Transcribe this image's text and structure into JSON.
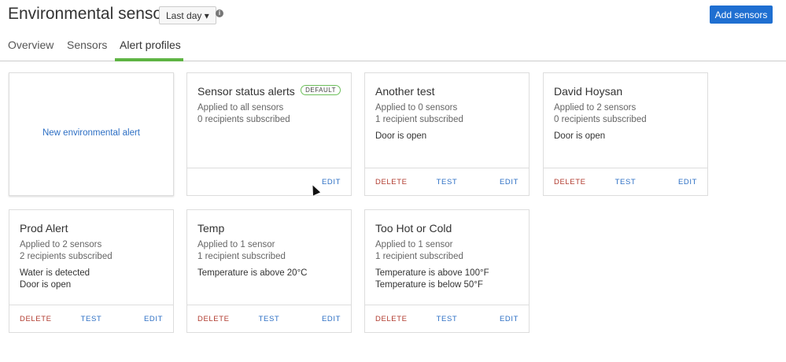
{
  "header": {
    "title": "Environmental sensors",
    "range": "Last day ▾",
    "info_icon": "i",
    "add_button": "Add sensors"
  },
  "tabs": [
    {
      "label": "Overview"
    },
    {
      "label": "Sensors"
    },
    {
      "label": "Alert profiles",
      "active": true
    }
  ],
  "new_alert": "New environmental alert",
  "actions": {
    "delete": "DELETE",
    "test": "TEST",
    "edit": "EDIT"
  },
  "cards": [
    {
      "title": "Sensor status alerts",
      "badge": "DEFAULT",
      "applied": "Applied to all sensors",
      "recipients": "0 recipients subscribed",
      "conditions": []
    },
    {
      "title": "Another test",
      "applied": "Applied to 0 sensors",
      "recipients": "1 recipient subscribed",
      "conditions": [
        "Door is open"
      ]
    },
    {
      "title": "David Hoysan",
      "applied": "Applied to 2 sensors",
      "recipients": "0 recipients subscribed",
      "conditions": [
        "Door is open"
      ]
    },
    {
      "title": "Prod Alert",
      "applied": "Applied to 2 sensors",
      "recipients": "2 recipients subscribed",
      "conditions": [
        "Water is detected",
        "Door is open"
      ]
    },
    {
      "title": "Temp",
      "applied": "Applied to 1 sensor",
      "recipients": "1 recipient subscribed",
      "conditions": [
        "Temperature is above 20°C"
      ]
    },
    {
      "title": "Too Hot or Cold",
      "applied": "Applied to 1 sensor",
      "recipients": "1 recipient subscribed",
      "conditions": [
        "Temperature is above 100°F",
        "Temperature is below 50°F"
      ]
    }
  ]
}
